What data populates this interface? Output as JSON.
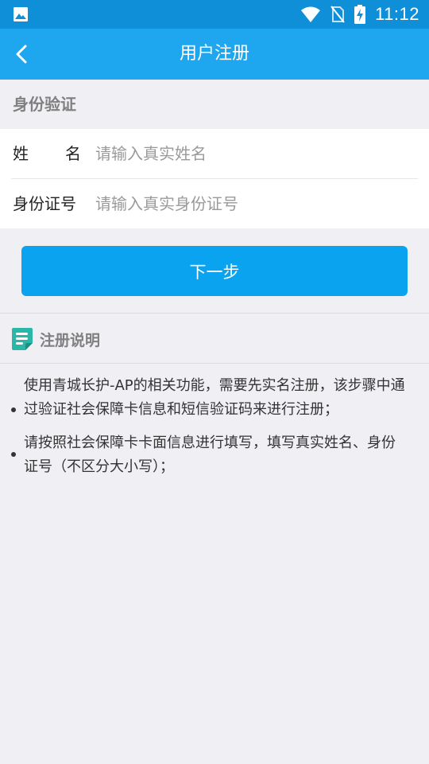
{
  "status_bar": {
    "time": "11:12",
    "icons": [
      "gallery-icon",
      "wifi-icon",
      "no-sim-icon",
      "battery-charging-icon"
    ]
  },
  "app_bar": {
    "title": "用户注册",
    "back_icon": "chevron-left-icon"
  },
  "identity_section": {
    "label": "身份验证",
    "name_label_chars": [
      "姓",
      "名"
    ],
    "name_placeholder": "请输入真实姓名",
    "id_label": "身份证号",
    "id_placeholder": "请输入真实身份证号"
  },
  "next_button_label": "下一步",
  "notes": {
    "title": "注册说明",
    "icon": "document-icon",
    "items": [
      "使用青城长护-AP的相关功能，需要先实名注册，该步骤中通过验证社会保障卡信息和短信验证码来进行注册；",
      "请按照社会保障卡卡面信息进行填写，填写真实姓名、身份证号（不区分大小写）；"
    ]
  },
  "colors": {
    "status_bar": "#0f8fd8",
    "app_bar": "#1ea7ee",
    "button": "#0aa3f0",
    "background": "#efeff4",
    "notes_icon": "#2bb7a7"
  }
}
